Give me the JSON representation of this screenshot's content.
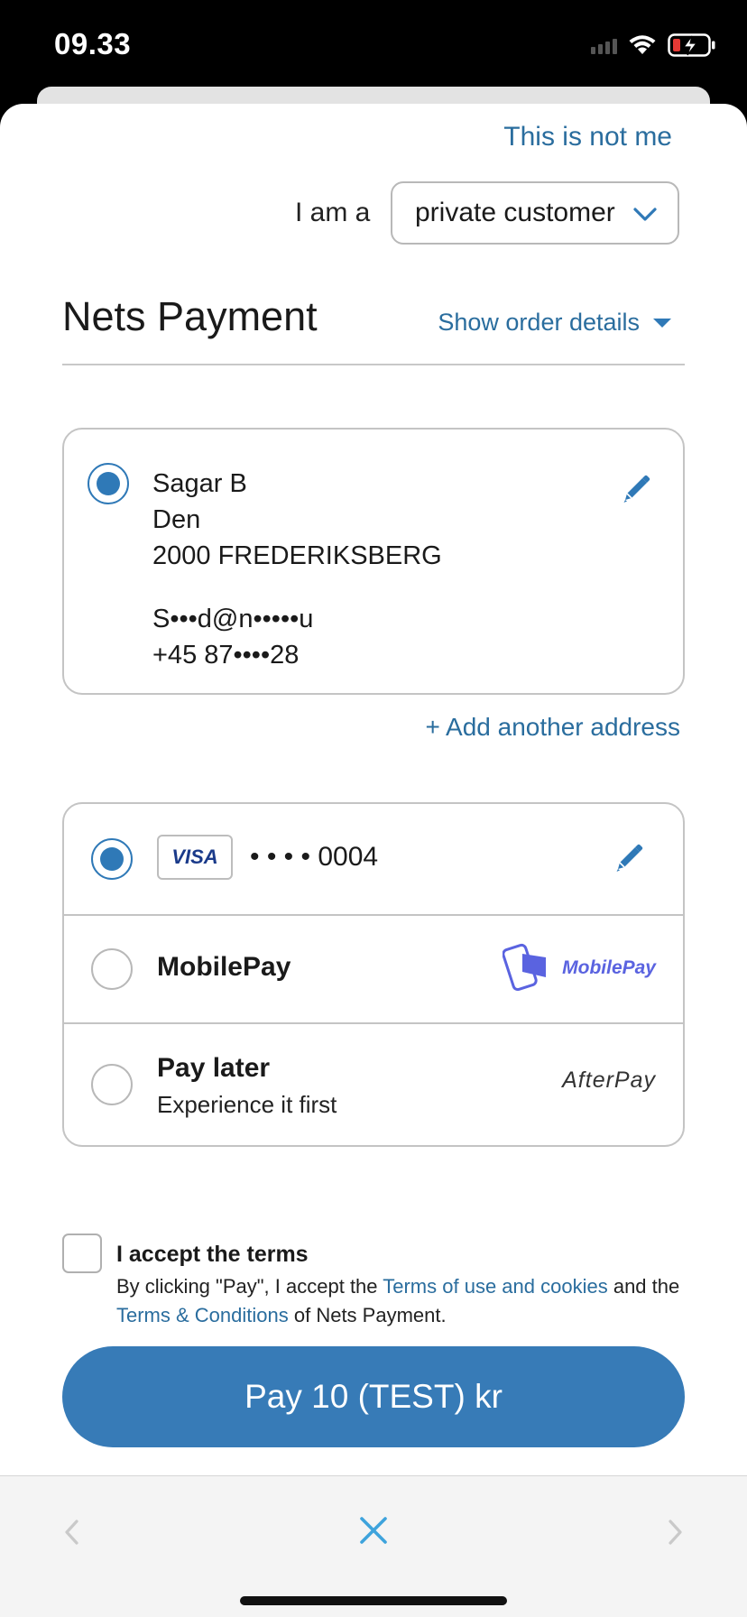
{
  "status_bar": {
    "time": "09.33"
  },
  "header": {
    "not_me_link": "This is not me",
    "i_am_a_label": "I am a",
    "customer_type": "private customer"
  },
  "title": "Nets Payment",
  "order_details_link": "Show order details",
  "address": {
    "selected": true,
    "name": "Sagar B",
    "line2": "Den",
    "city": "2000 FREDERIKSBERG",
    "email": "S•••d@n•••••u",
    "phone": "+45 87••••28"
  },
  "add_address_link": "+ Add another address",
  "payment_methods": {
    "card": {
      "selected": true,
      "brand": "VISA",
      "masked_number": "• • • • 0004"
    },
    "mobilepay": {
      "selected": false,
      "label": "MobilePay",
      "logo_text": "MobilePay"
    },
    "paylater": {
      "selected": false,
      "label": "Pay later",
      "sublabel": "Experience it first",
      "logo_text": "AfterPay"
    }
  },
  "terms": {
    "checked": false,
    "title": "I accept the terms",
    "text_1": "By clicking \"Pay\", I accept the ",
    "link_1": "Terms of use and cookies",
    "text_2": " and the ",
    "link_2": "Terms & Conditions",
    "text_3": " of Nets Payment."
  },
  "pay_button": "Pay 10 (TEST) kr",
  "colors": {
    "accent": "#377bb7",
    "link": "#2a6d9e",
    "battery_low": "#e53935"
  },
  "icons": [
    "wifi-icon",
    "battery-icon",
    "chevron-down-icon",
    "caret-down-icon",
    "pencil-icon",
    "back-icon",
    "close-icon",
    "forward-icon"
  ]
}
